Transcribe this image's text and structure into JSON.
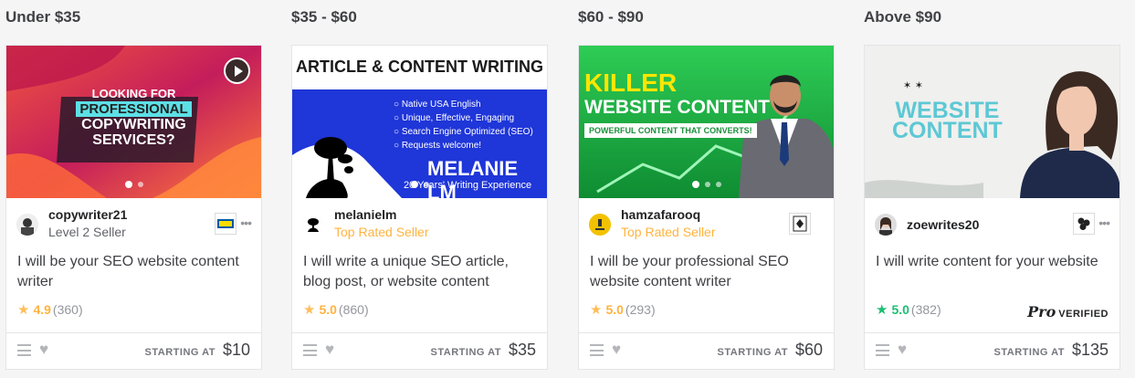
{
  "cards": [
    {
      "heading": "Under $35",
      "seller": "copywriter21",
      "level": "Level 2 Seller",
      "title": "I will be your SEO website content writer",
      "rating": "4.9",
      "reviews": "(360)",
      "price_label": "STARTING AT",
      "price": "$10",
      "badge_icon": "ikea-logo-icon",
      "thumb_text": {
        "line1": "LOOKING FOR",
        "line2": "PROFESSIONAL",
        "line3": "COPYWRITING",
        "line4": "SERVICES?"
      }
    },
    {
      "heading": "$35 - $60",
      "seller": "melanielm",
      "level": "Top Rated Seller",
      "title": "I will write a unique SEO article, blog post, or website content",
      "rating": "5.0",
      "reviews": "(860)",
      "price_label": "STARTING AT",
      "price": "$35",
      "thumb_text": {
        "banner": "ARTICLE & CONTENT WRITING",
        "bullets": [
          "Native USA English",
          "Unique, Effective, Engaging",
          "Search Engine Optimized (SEO)",
          "Requests welcome!"
        ],
        "name": "MELANIE LM",
        "tagline": "20 Years' Writing Experience"
      }
    },
    {
      "heading": "$60 - $90",
      "seller": "hamzafarooq",
      "level": "Top Rated Seller",
      "title": "I will be your professional SEO website content writer",
      "rating": "5.0",
      "reviews": "(293)",
      "price_label": "STARTING AT",
      "price": "$60",
      "badge_icon": "card-logo-icon",
      "thumb_text": {
        "line1": "KILLER",
        "line2": "WEBSITE CONTENT",
        "tagline": "POWERFUL CONTENT THAT CONVERTS!"
      }
    },
    {
      "heading": "Above $90",
      "seller": "zoewrites20",
      "level": "",
      "title": "I will write content for your website",
      "rating": "5.0",
      "reviews": "(382)",
      "price_label": "STARTING AT",
      "price": "$135",
      "badge_icon": "dots-logo-icon",
      "pro_word": "Pro",
      "pro_verified": "VERIFIED",
      "thumb_text": {
        "line1": "WEBSITE",
        "line2": "CONTENT"
      }
    }
  ],
  "colors": {
    "star_gold": "#ffbe5b",
    "star_green": "#1dbf73",
    "top_rated": "#ffb33e"
  }
}
